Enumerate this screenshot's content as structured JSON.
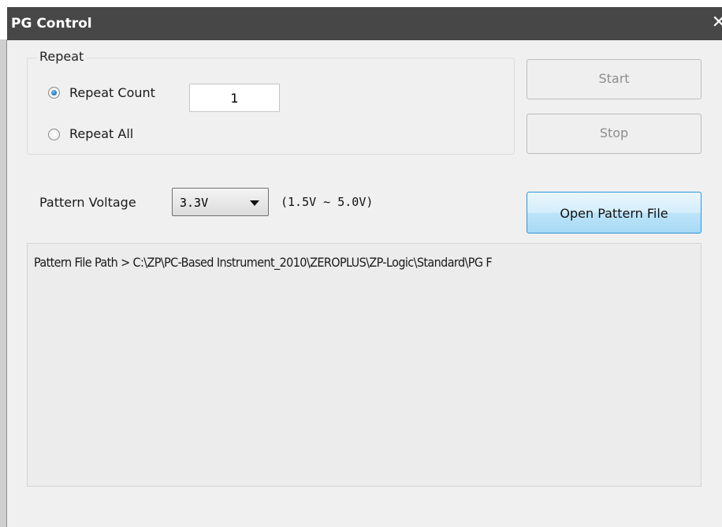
{
  "window": {
    "title": "PG Control",
    "close_glyph": "✕"
  },
  "repeat": {
    "legend": "Repeat",
    "repeat_count_label": "Repeat Count",
    "repeat_count_value": "1",
    "repeat_all_label": "Repeat All",
    "selected": "repeat_count"
  },
  "buttons": {
    "start_label": "Start",
    "stop_label": "Stop",
    "open_pattern_label": "Open Pattern File"
  },
  "voltage": {
    "label": "Pattern Voltage",
    "selected": "3.3V",
    "range": "(1.5V ~ 5.0V)"
  },
  "path": {
    "text": "Pattern File Path > C:\\ZP\\PC-Based Instrument_2010\\ZEROPLUS\\ZP-Logic\\Standard\\PG F"
  },
  "colors": {
    "titlebar": "#474747",
    "open_button_border": "#2f95d6",
    "radio_selected": "#1f6fb0"
  },
  "icons": {
    "close": "close-icon",
    "dropdown": "chevron-down-icon"
  }
}
